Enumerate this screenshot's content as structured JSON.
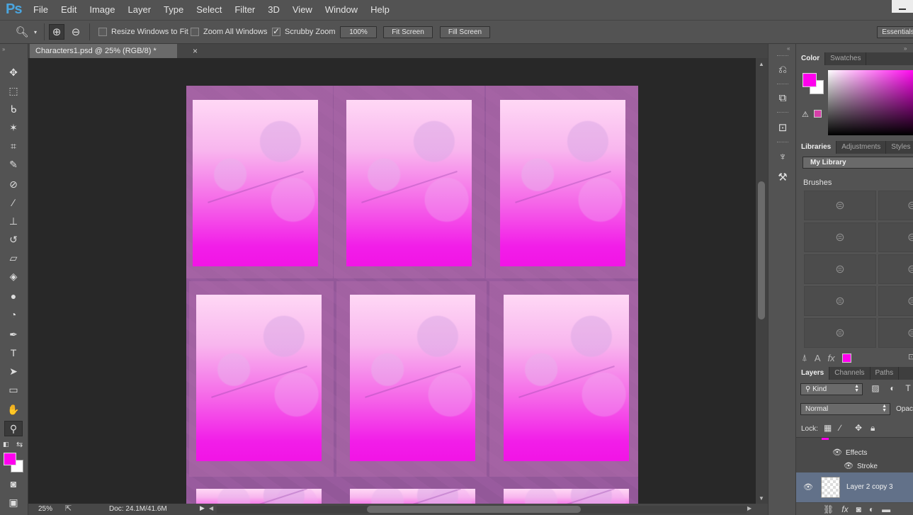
{
  "app": {
    "logo": "Ps"
  },
  "menu": [
    "File",
    "Edit",
    "Image",
    "Layer",
    "Type",
    "Select",
    "Filter",
    "3D",
    "View",
    "Window",
    "Help"
  ],
  "options": {
    "resize_windows": "Resize Windows to Fit",
    "zoom_all": "Zoom All Windows",
    "scrubby_zoom": "Scrubby Zoom",
    "zoom_percent": "100%",
    "fit_screen": "Fit Screen",
    "fill_screen": "Fill Screen",
    "workspace": "Essentials"
  },
  "document": {
    "tab_title": "Characters1.psd @ 25% (RGB/8) *",
    "close": "×"
  },
  "status": {
    "zoom": "25%",
    "doc": "Doc: 24.1M/41.6M"
  },
  "colors": {
    "foreground": "#ff00ee",
    "background": "#ffffff",
    "accent_selected_layer": "#627189"
  },
  "panels": {
    "color_tabs": [
      "Color",
      "Swatches"
    ],
    "library_tabs": [
      "Libraries",
      "Adjustments",
      "Styles"
    ],
    "library_name": "My Library",
    "brushes_label": "Brushes",
    "layers_tabs": [
      "Layers",
      "Channels",
      "Paths"
    ],
    "kind_filter": "Kind",
    "blend_mode": "Normal",
    "opacity_label": "Opac",
    "lock_label": "Lock:",
    "layers": {
      "effects": "Effects",
      "stroke": "Stroke",
      "selected_layer": "Layer 2 copy 3"
    }
  },
  "icons": {
    "toolbox": [
      "move-icon",
      "marquee-icon",
      "lasso-icon",
      "magic-wand-icon",
      "crop-icon",
      "eyedropper-icon",
      "healing-brush-icon",
      "brush-icon",
      "clone-stamp-icon",
      "history-brush-icon",
      "eraser-icon",
      "paint-bucket-icon",
      "blur-icon",
      "dodge-icon",
      "pen-icon",
      "type-icon",
      "path-selection-icon",
      "rectangle-icon",
      "hand-icon",
      "zoom-icon",
      "quick-mask-icon",
      "screen-mode-icon"
    ],
    "strip": [
      "history-icon",
      "3d-icon",
      "properties-icon",
      "brush-presets-icon",
      "tool-presets-icon"
    ]
  }
}
